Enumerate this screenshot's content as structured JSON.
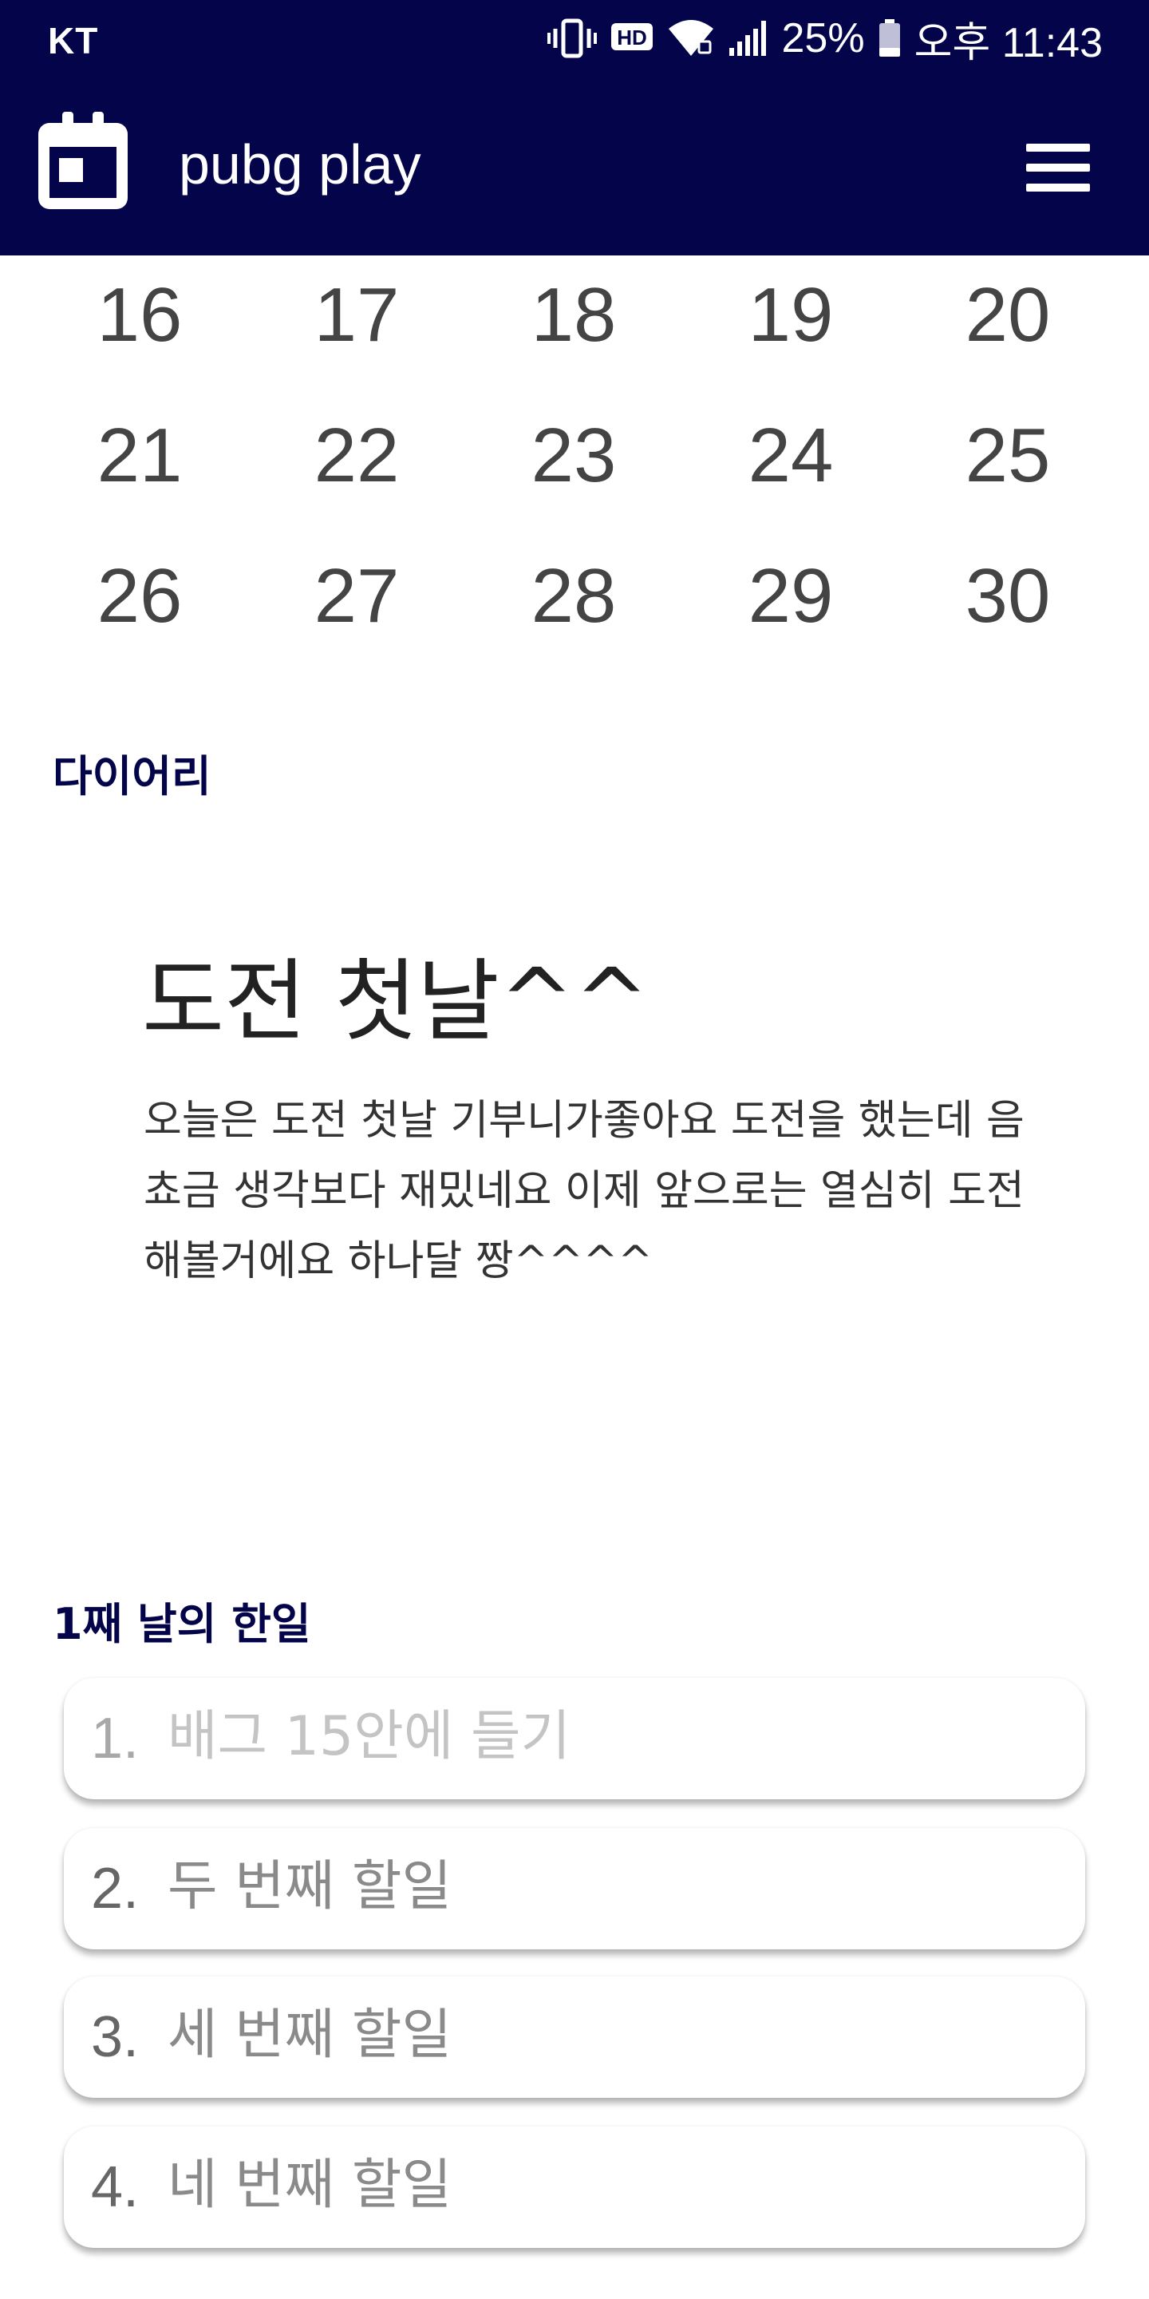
{
  "status_bar": {
    "carrier": "KT",
    "icons": [
      "vibrate-icon",
      "hd-icon",
      "wifi-icon",
      "signal-icon",
      "battery-icon"
    ],
    "hd_label": "HD",
    "battery": "25%",
    "time": "오후 11:43"
  },
  "app_bar": {
    "icon": "calendar-icon",
    "title": "pubg play",
    "menu_icon": "hamburger-menu-icon"
  },
  "calendar": {
    "rows": [
      [
        "16",
        "17",
        "18",
        "19",
        "20"
      ],
      [
        "21",
        "22",
        "23",
        "24",
        "25"
      ],
      [
        "26",
        "27",
        "28",
        "29",
        "30"
      ]
    ]
  },
  "diary": {
    "section_label": "다이어리",
    "title": "도전 첫날^^",
    "body": "오늘은 도전 첫날 기부니가좋아요 도전을 했는데 음 쵸금 생각보다 재밌네요 이제 앞으로는 열심히 도전 해볼거에요 하나달 짱^^^^"
  },
  "todos": {
    "section_label": "1째 날의 한일",
    "items": [
      {
        "number": "1.",
        "text": "배그 15안에 들기"
      },
      {
        "number": "2.",
        "text": "두 번째 할일"
      },
      {
        "number": "3.",
        "text": "세 번째 할일"
      },
      {
        "number": "4.",
        "text": "네 번째 할일"
      }
    ]
  },
  "colors": {
    "header_bg": "#03044a",
    "section_label": "#03044a",
    "calendar_text": "#444444",
    "todo_placeholder": "#c4c4c4"
  }
}
